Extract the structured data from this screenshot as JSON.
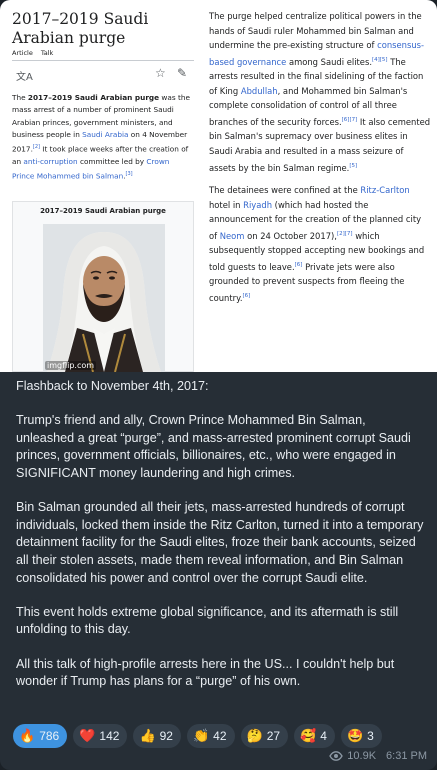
{
  "wiki": {
    "title": "2017–2019 Saudi Arabian purge",
    "tabs": [
      "Article",
      "Talk"
    ],
    "lead": {
      "prefix": "The ",
      "bold": "2017–2019 Saudi Arabian purge",
      "t1": " was the mass arrest of a number of prominent Saudi Arabian princes, government ministers, and business people in ",
      "link1": "Saudi Arabia",
      "t2": " on 4 November 2017.",
      "ref1": "[2]",
      "t3": " It took place weeks after the creation of an ",
      "link2": "anti-corruption",
      "t4": " committee led by ",
      "link3": "Crown Prince Mohammed bin Salman",
      "t5": ".",
      "ref2": "[3]"
    },
    "infobox_caption": "2017–2019 Saudi Arabian purge",
    "watermark": "imgflip.com",
    "p1": {
      "t1": "The purge helped centralize political powers in the hands of Saudi ruler Mohammed bin Salman and undermine the pre-existing structure of ",
      "link1": "consensus-based governance",
      "t2": " among Saudi elites.",
      "ref1": "[4][5]",
      "t3": " The arrests resulted in the final sidelining of the faction of King ",
      "link2": "Abdullah",
      "t4": ", and Mohammed bin Salman's complete consolidation of control of all three branches of the security forces.",
      "ref2": "[6][7]",
      "t5": " It also cemented bin Salman's supremacy over business elites in Saudi Arabia and resulted in a mass seizure of assets by the bin Salman regime.",
      "ref3": "[5]"
    },
    "p2": {
      "t1": "The detainees were confined at the ",
      "link1": "Ritz-Carlton",
      "t2": " hotel in ",
      "link2": "Riyadh",
      "t3": " (which had hosted the announcement for the creation of the planned city of ",
      "link3": "Neom",
      "t4": " on 24 October 2017),",
      "ref1": "[2][7]",
      "t5": " which subsequently stopped accepting new bookings and told guests to leave.",
      "ref2": "[6]",
      "t6": " Private jets were also grounded to prevent suspects from fleeing the country.",
      "ref3": "[6]"
    }
  },
  "message": {
    "paragraphs": [
      "Flashback to November 4th, 2017:",
      "Trump's friend and ally, Crown Prince Mohammed Bin Salman, unleashed a great “purge”, and mass-arrested prominent corrupt Saudi princes, government officials, billionaires, etc., who were engaged in SIGNIFICANT money laundering and high crimes.",
      "Bin Salman grounded all their jets, mass-arrested hundreds of corrupt individuals, locked them inside the Ritz Carlton, turned it into a temporary detainment facility for the Saudi elites, froze their bank accounts, seized all their stolen assets, made them reveal information, and Bin Salman consolidated his power and control over the corrupt Saudi elite.",
      "This event holds extreme global significance, and its aftermath is still unfolding to this day.",
      "All this talk of high-profile arrests here in the US... I couldn't help but wonder if Trump has plans for a “purge” of his own."
    ]
  },
  "reactions": [
    {
      "emoji": "🔥",
      "count": "786",
      "active": true
    },
    {
      "emoji": "❤️",
      "count": "142",
      "active": false
    },
    {
      "emoji": "👍",
      "count": "92",
      "active": false
    },
    {
      "emoji": "👏",
      "count": "42",
      "active": false
    },
    {
      "emoji": "🤔",
      "count": "27",
      "active": false
    },
    {
      "emoji": "🥰",
      "count": "4",
      "active": false
    },
    {
      "emoji": "🤩",
      "count": "3",
      "active": false
    }
  ],
  "meta": {
    "views": "10.9K",
    "time": "6:31 PM"
  },
  "icons": {
    "language": "translate-icon",
    "star": "star-icon",
    "edit": "pencil-icon",
    "views": "eye-icon"
  },
  "colors": {
    "link": "#3366cc",
    "bubble": "#262e36",
    "active_reaction": "#3e93e0"
  }
}
